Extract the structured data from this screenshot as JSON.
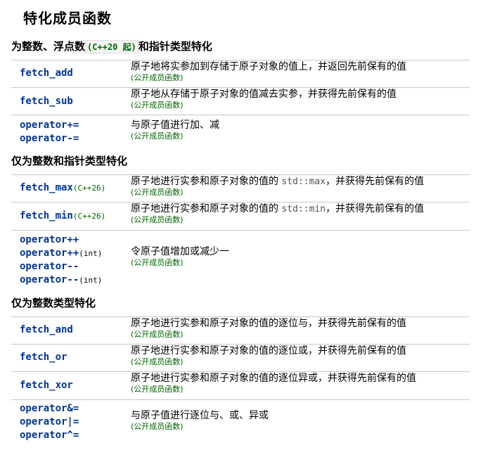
{
  "title": "特化成员函数",
  "sections": [
    {
      "heading_pre": "为整数、浮点数",
      "heading_badge": "(C++20 起)",
      "heading_post": "和指针类型特化"
    },
    {
      "heading": "仅为整数和指针类型特化"
    },
    {
      "heading": "仅为整数类型特化"
    }
  ],
  "note": "(公开成员函数)",
  "rows": {
    "fetch_add": {
      "name": "fetch_add",
      "desc": "原子地将实参加到存储于原子对象的值上，并返回先前保有的值"
    },
    "fetch_sub": {
      "name": "fetch_sub",
      "desc": "原子地从存储于原子对象的值减去实参，并获得先前保有的值"
    },
    "op_addsub": {
      "names": [
        "operator+=",
        "operator-="
      ],
      "desc": "与原子值进行加、减"
    },
    "fetch_max": {
      "name": "fetch_max",
      "ver": "(C++26)",
      "desc_pre": "原子地进行实参和原子对象的值的 ",
      "code": "std::max",
      "desc_post": "，并获得先前保有的值"
    },
    "fetch_min": {
      "name": "fetch_min",
      "ver": "(C++26)",
      "desc_pre": "原子地进行实参和原子对象的值的 ",
      "code": "std::min",
      "desc_post": "，并获得先前保有的值"
    },
    "op_incdec": {
      "names": [
        "operator++",
        "operator++",
        "operator--",
        "operator--"
      ],
      "suffix": "(int)",
      "desc": "令原子值增加或减少一"
    },
    "fetch_and": {
      "name": "fetch_and",
      "desc": "原子地进行实参和原子对象的值的逐位与，并获得先前保有的值"
    },
    "fetch_or": {
      "name": "fetch_or",
      "desc": "原子地进行实参和原子对象的值的逐位或，并获得先前保有的值"
    },
    "fetch_xor": {
      "name": "fetch_xor",
      "desc": "原子地进行实参和原子对象的值的逐位异或，并获得先前保有的值"
    },
    "op_bitwise": {
      "names": [
        "operator&=",
        "operator|=",
        "operator^="
      ],
      "desc": "与原子值进行逐位与、或、异或"
    }
  }
}
